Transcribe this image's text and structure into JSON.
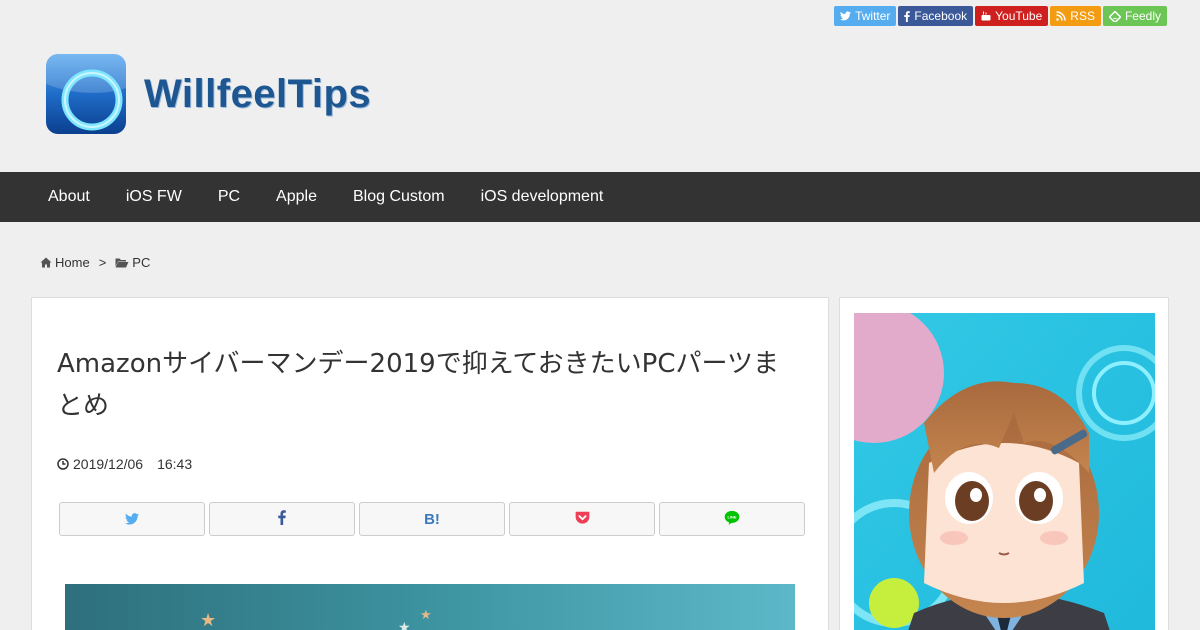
{
  "social": {
    "twitter": "Twitter",
    "facebook": "Facebook",
    "youtube": "YouTube",
    "rss": "RSS",
    "feedly": "Feedly"
  },
  "site": {
    "logo_text": "WillfeelTips"
  },
  "nav": {
    "items": [
      "About",
      "iOS FW",
      "PC",
      "Apple",
      "Blog Custom",
      "iOS development"
    ]
  },
  "breadcrumb": {
    "home": "Home",
    "separator": ">",
    "category": "PC"
  },
  "post": {
    "title": "Amazonサイバーマンデー2019で抑えておきたいPCパーツまとめ",
    "date": "2019/12/06",
    "time": "16:43"
  },
  "share": {
    "hatena_label": "B!",
    "buttons": [
      "twitter-icon",
      "facebook-icon",
      "hatena-icon",
      "pocket-icon",
      "line-icon"
    ]
  },
  "colors": {
    "nav_bg": "#333333",
    "twitter": "#55acee",
    "facebook": "#3b5998",
    "youtube": "#cd201f",
    "rss": "#f39c12",
    "feedly": "#6cc655",
    "logo_text": "#1d5690"
  }
}
